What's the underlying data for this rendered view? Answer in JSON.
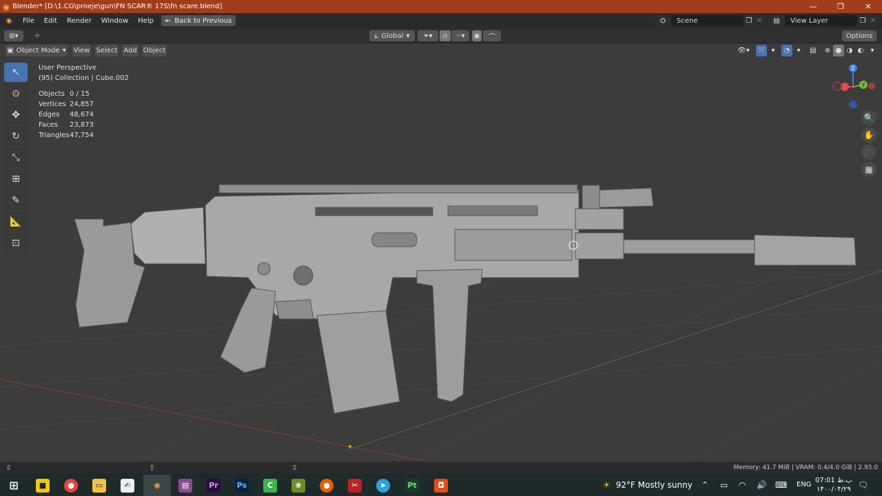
{
  "titlebar": {
    "title": "Blender* [D:\\1.CG\\proeje\\gun\\FN SCAR® 17S\\fn scare.blend]",
    "minimize": "—",
    "maximize": "❐",
    "close": "✕"
  },
  "menu": {
    "items": [
      "File",
      "Edit",
      "Render",
      "Window",
      "Help"
    ],
    "back_button": "Back to Previous"
  },
  "workspace": {
    "scene": "Scene",
    "view_layer": "View Layer"
  },
  "header": {
    "orientation": "Global",
    "options": "Options"
  },
  "viewport_header": {
    "mode": "Object Mode",
    "menus": [
      "View",
      "Select",
      "Add",
      "Object"
    ]
  },
  "overlay": {
    "perspective": "User Perspective",
    "collection": "(95) Collection | Cube.002",
    "stats": [
      {
        "label": "Objects",
        "value": "0 / 15"
      },
      {
        "label": "Vertices",
        "value": "24,857"
      },
      {
        "label": "Edges",
        "value": "48,674"
      },
      {
        "label": "Faces",
        "value": "23,873"
      },
      {
        "label": "Triangles",
        "value": "47,754"
      }
    ]
  },
  "gizmo": {
    "z": "Z",
    "y": "Y",
    "x_color": "#e04b4b",
    "y_color": "#7ab33a",
    "z_color": "#3b7fd8"
  },
  "statusbar": {
    "text": "Memory: 41.7 MiB | VRAM: 0.4/4.0 GiB | 2.93.0"
  },
  "taskbar": {
    "weather": "92°F  Mostly sunny",
    "lang": "ENG",
    "time": "07:01 ب.ظ",
    "date": "۱۴۰۰/۰۴/۲۹"
  }
}
